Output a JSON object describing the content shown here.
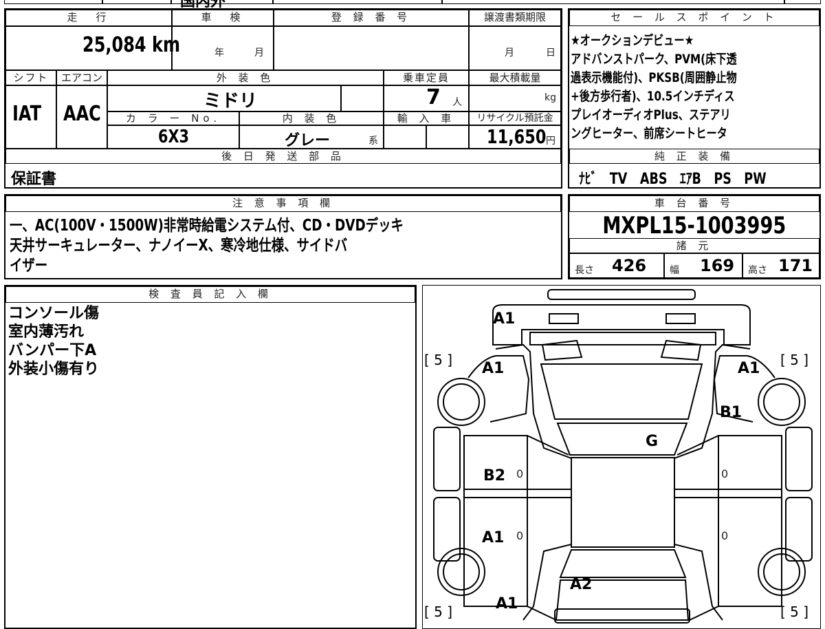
{
  "top_strip": {
    "partial_title": "国内外"
  },
  "vehicle": {
    "headers": {
      "mileage": "走　行",
      "inspection": "車　検",
      "registration": "登 録 番 号",
      "transfer_deadline": "譲渡書類期限",
      "shift": "シフト",
      "aircon": "エアコン",
      "exterior_color": "外 装 色",
      "capacity": "乗車定員",
      "max_load": "最大積載量",
      "color_no": "カ ラ ー No.",
      "interior_color": "内 装 色",
      "import": "輸 入 車",
      "recycle": "リサイクル預託金"
    },
    "mileage": "25,084",
    "mileage_unit": "km",
    "inspection_year": "年",
    "inspection_month": "月",
    "transfer_month": "月",
    "transfer_day": "日",
    "shift": "IAT",
    "aircon": "AAC",
    "exterior_color": "ミドリ",
    "capacity": "7",
    "capacity_unit": "人",
    "max_load_unit": "kg",
    "color_no": "6X3",
    "interior_color": "グレー",
    "interior_suffix": "系",
    "recycle_fee": "11,650",
    "recycle_unit": "円"
  },
  "later_parts": {
    "header": "後 日 発 送 部 品",
    "value": "保証書"
  },
  "sales_points": {
    "header": "セ ー ル ス ポ イ ン ト",
    "lines": [
      "★オークションデビュー★",
      "アドバンストパーク、PVM(床下透",
      "過表示機能付)、PKSB(周囲静止物",
      "+後方歩行者)、10.5インチディス",
      "プレイオーディオPlus、ステアリ",
      "ングヒーター、前席シートヒータ"
    ]
  },
  "genuine_equipment": {
    "header": "純 正 装 備",
    "items": [
      "ﾅﾋﾞ",
      "TV",
      "ABS",
      "ｴｱB",
      "PS",
      "PW"
    ]
  },
  "notes": {
    "header": "注 意 事 項 欄",
    "lines": [
      "一、AC(100V・1500W)非常時給電システム付、CD・DVDデッキ",
      "天井サーキュレーター、ナノイーX、寒冷地仕様、サイドバ",
      "イザー"
    ]
  },
  "chassis": {
    "header": "車 台 番 号",
    "number": "MXPL15-1003995"
  },
  "specs": {
    "header": "諸 元",
    "length_label": "長さ",
    "length": "426",
    "width_label": "幅",
    "width": "169",
    "height_label": "高さ",
    "height": "171"
  },
  "inspector": {
    "header": "検 査 員 記 入 欄",
    "lines": [
      "コンソール傷",
      "室内薄汚れ",
      "バンパー下A",
      "外装小傷有り"
    ]
  },
  "diagram": {
    "marks": {
      "front_bumper": "A1",
      "front_left": "A1",
      "front_right": "A1",
      "right_front_fender": "B1",
      "windshield": "G",
      "left_front_door": "B2",
      "left_rear_door": "A1",
      "rear": "A2",
      "rear_bumper": "A1",
      "door_zero_1": "0",
      "door_zero_2": "0",
      "door_zero_3": "0",
      "door_zero_4": "0"
    },
    "tire_labels": [
      "[ 5 ]",
      "[ 5 ]",
      "[ 5 ]",
      "[ 5 ]"
    ]
  }
}
